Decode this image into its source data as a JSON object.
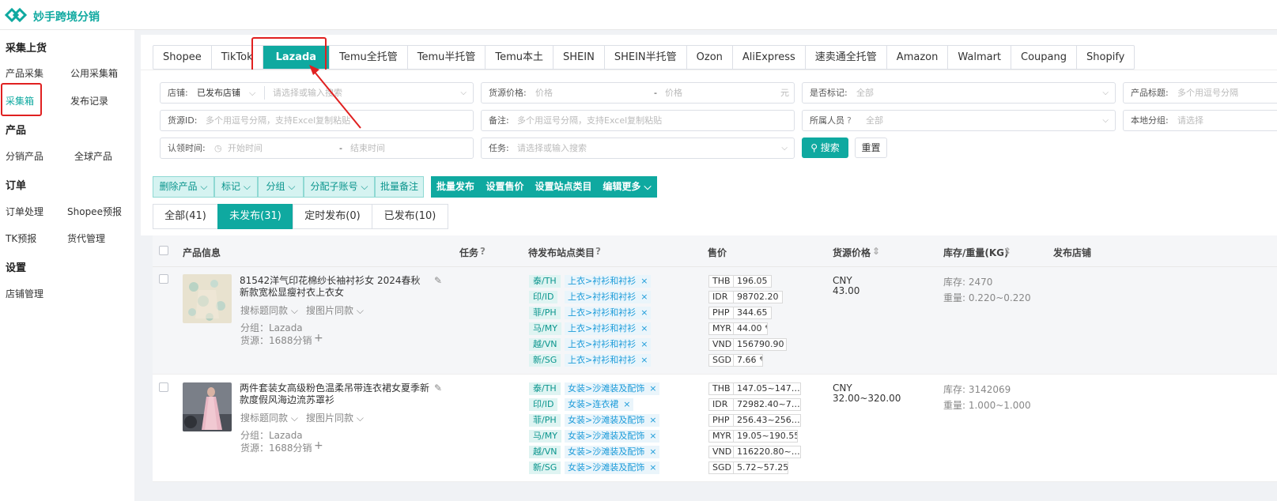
{
  "app": {
    "title": "妙手跨境分销"
  },
  "sidebar": {
    "sections": [
      {
        "title": "采集上货",
        "items": [
          "产品采集",
          "公用采集箱",
          "采集箱",
          "发布记录"
        ]
      },
      {
        "title": "产品",
        "items": [
          "分销产品",
          "全球产品"
        ]
      },
      {
        "title": "订单",
        "items": [
          "订单处理",
          "Shopee预报",
          "TK预报",
          "货代管理"
        ]
      },
      {
        "title": "设置",
        "items": [
          "店铺管理"
        ]
      }
    ],
    "active": "采集箱"
  },
  "platform_tabs": [
    "Shopee",
    "TikTok",
    "Lazada",
    "Temu全托管",
    "Temu半托管",
    "Temu本土",
    "SHEIN",
    "SHEIN半托管",
    "Ozon",
    "AliExpress",
    "速卖通全托管",
    "Amazon",
    "Walmart",
    "Coupang",
    "Shopify"
  ],
  "active_platform": "Lazada",
  "filters": {
    "shop": {
      "label": "店铺:",
      "value": "已发布店铺",
      "placeholder": "请选择或输入搜索"
    },
    "source_price": {
      "label": "货源价格:",
      "min_ph": "价格",
      "sep": "-",
      "max_ph": "价格",
      "unit": "元"
    },
    "marked": {
      "label": "是否标记:",
      "value": "全部"
    },
    "product_title": {
      "label": "产品标题:",
      "placeholder": "多个用逗号分隔"
    },
    "source_id": {
      "label": "货源ID:",
      "placeholder": "多个用逗号分隔，支持Excel复制粘贴"
    },
    "note": {
      "label": "备注:",
      "placeholder": "多个用逗号分隔，支持Excel复制粘贴"
    },
    "owner": {
      "label": "所属人员",
      "value": "全部"
    },
    "local_group": {
      "label": "本地分组:",
      "placeholder": "请选择"
    },
    "claim_time": {
      "label": "认领时间:",
      "start_ph": "开始时间",
      "sep": "-",
      "end_ph": "结束时间"
    },
    "task": {
      "label": "任务:",
      "placeholder": "请选择或输入搜索"
    },
    "search_btn": "搜索",
    "reset_btn": "重置"
  },
  "actions": {
    "light": [
      "删除产品",
      "标记",
      "分组",
      "分配子账号",
      "批量备注"
    ],
    "dark": [
      "批量发布",
      "设置售价",
      "设置站点类目",
      "编辑更多"
    ]
  },
  "status_tabs": [
    "全部(41)",
    "未发布(31)",
    "定时发布(0)",
    "已发布(10)"
  ],
  "active_status": "未发布(31)",
  "table": {
    "headers": [
      "产品信息",
      "任务",
      "待发布站点类目",
      "售价",
      "货源价格",
      "库存/重量(KG)",
      "发布店铺"
    ],
    "rows": [
      {
        "title": "81542洋气印花棉纱长袖衬衫女 2024春秋新款宽松显瘦衬衣上衣女",
        "search_title": "搜标题同款",
        "search_image": "搜图片同款",
        "group": "分组：Lazada",
        "source_label": "货源：",
        "source": "1688分销",
        "sites": [
          {
            "site": "泰/TH",
            "category": "上衣>衬衫和衬衫"
          },
          {
            "site": "印/ID",
            "category": "上衣>衬衫和衬衫"
          },
          {
            "site": "菲/PH",
            "category": "上衣>衬衫和衬衫"
          },
          {
            "site": "马/MY",
            "category": "上衣>衬衫和衬衫"
          },
          {
            "site": "越/VN",
            "category": "上衣>衬衫和衬衫"
          },
          {
            "site": "新/SG",
            "category": "上衣>衬衫和衬衫"
          }
        ],
        "prices": [
          {
            "cur": "THB",
            "amt": "196.05"
          },
          {
            "cur": "IDR",
            "amt": "98702.20"
          },
          {
            "cur": "PHP",
            "amt": "344.65"
          },
          {
            "cur": "MYR",
            "amt": "44.00"
          },
          {
            "cur": "VND",
            "amt": "156790.90"
          },
          {
            "cur": "SGD",
            "amt": "7.66"
          }
        ],
        "source_currency": "CNY",
        "source_price": "43.00",
        "stock": "库存:  2470",
        "weight": "重量:  0.220~0.220"
      },
      {
        "title": "两件套装女高级粉色温柔吊带连衣裙女夏季新款度假风海边流苏罩衫",
        "search_title": "搜标题同款",
        "search_image": "搜图片同款",
        "group": "分组：Lazada",
        "source_label": "货源：",
        "source": "1688分销",
        "sites": [
          {
            "site": "泰/TH",
            "category": "女装>沙滩装及配饰"
          },
          {
            "site": "印/ID",
            "category": "女装>连衣裙"
          },
          {
            "site": "菲/PH",
            "category": "女装>沙滩装及配饰"
          },
          {
            "site": "马/MY",
            "category": "女装>沙滩装及配饰"
          },
          {
            "site": "越/VN",
            "category": "女装>沙滩装及配饰"
          },
          {
            "site": "新/SG",
            "category": "女装>沙滩装及配饰"
          }
        ],
        "prices": [
          {
            "cur": "THB",
            "amt": "147.05~147…"
          },
          {
            "cur": "IDR",
            "amt": "72982.40~7…"
          },
          {
            "cur": "PHP",
            "amt": "256.43~256…"
          },
          {
            "cur": "MYR",
            "amt": "19.05~190.55"
          },
          {
            "cur": "VND",
            "amt": "116220.80~…"
          },
          {
            "cur": "SGD",
            "amt": "5.72~57.25"
          }
        ],
        "source_currency": "CNY",
        "source_price": "32.00~320.00",
        "stock": "库存:  3142069",
        "weight": "重量:  1.000~1.000"
      }
    ]
  },
  "colors": {
    "accent": "#0fa9a0",
    "highlight": "#e02020",
    "category_link": "#1c9bd9"
  }
}
